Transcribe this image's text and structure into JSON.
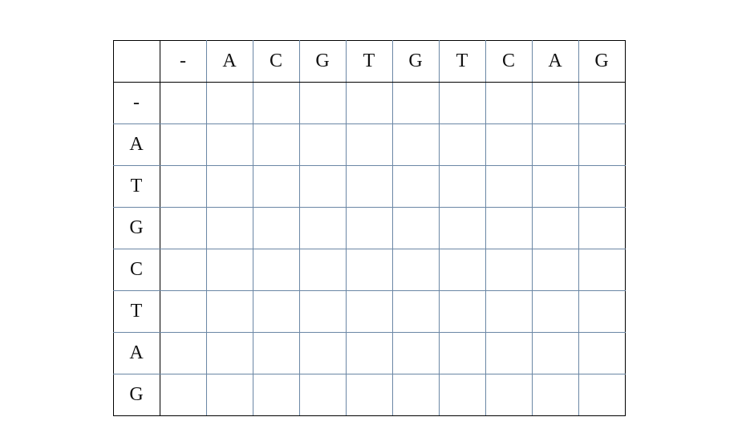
{
  "chart_data": {
    "type": "table",
    "title": "",
    "column_headers": [
      "",
      "-",
      "A",
      "C",
      "G",
      "T",
      "G",
      "T",
      "C",
      "A",
      "G"
    ],
    "row_headers": [
      "-",
      "A",
      "T",
      "G",
      "C",
      "T",
      "A",
      "G"
    ],
    "cells": [
      [
        "",
        "",
        "",
        "",
        "",
        "",
        "",
        "",
        "",
        ""
      ],
      [
        "",
        "",
        "",
        "",
        "",
        "",
        "",
        "",
        "",
        ""
      ],
      [
        "",
        "",
        "",
        "",
        "",
        "",
        "",
        "",
        "",
        ""
      ],
      [
        "",
        "",
        "",
        "",
        "",
        "",
        "",
        "",
        "",
        ""
      ],
      [
        "",
        "",
        "",
        "",
        "",
        "",
        "",
        "",
        "",
        ""
      ],
      [
        "",
        "",
        "",
        "",
        "",
        "",
        "",
        "",
        "",
        ""
      ],
      [
        "",
        "",
        "",
        "",
        "",
        "",
        "",
        "",
        "",
        ""
      ],
      [
        "",
        "",
        "",
        "",
        "",
        "",
        "",
        "",
        "",
        ""
      ]
    ]
  }
}
